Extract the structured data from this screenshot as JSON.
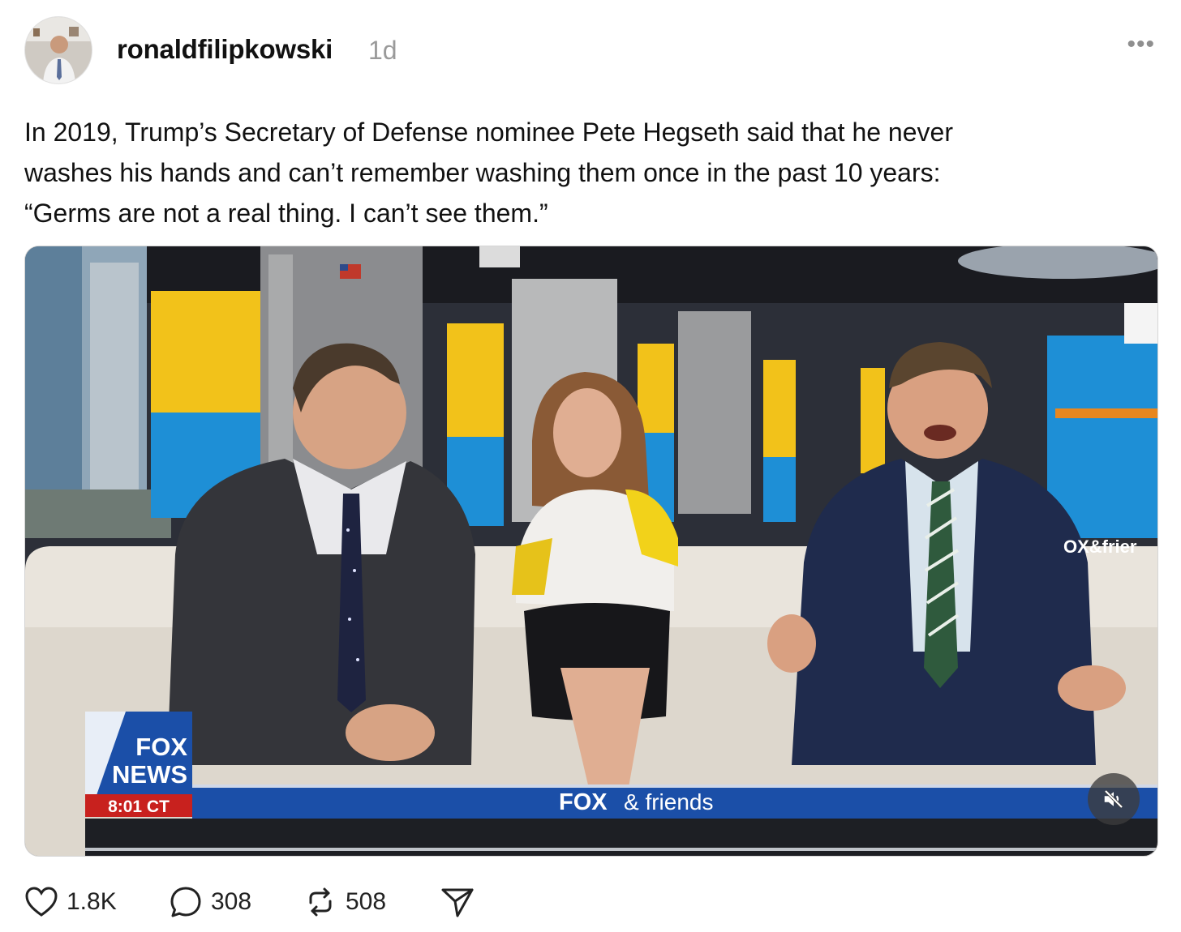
{
  "post": {
    "username": "ronaldfilipkowski",
    "time": "1d",
    "more_label": "•••",
    "text_lines": [
      "In 2019, Trump’s Secretary of Defense nominee Pete Hegseth said that he never",
      "washes his hands and can’t remember washing them once in the past 10 years:",
      "“Germs are not a real thing. I can’t see them.”"
    ]
  },
  "video": {
    "network_logo_line1": "FOX",
    "network_logo_line2": "NEWS",
    "clock": "8:01 CT",
    "show_brand": "FOX",
    "show_name": "& friends",
    "corner_bug": "OX&frier",
    "mute_icon": "speaker-muted-icon"
  },
  "actions": {
    "likes": "1.8K",
    "replies": "308",
    "reposts": "508"
  },
  "colors": {
    "username": "#111111",
    "timestamp": "#9a9a9a",
    "ticker_blue": "#1b4fa8",
    "fox_red": "#c8211e",
    "studio_yellow": "#f2c21a",
    "studio_blue": "#1e8fd6"
  }
}
